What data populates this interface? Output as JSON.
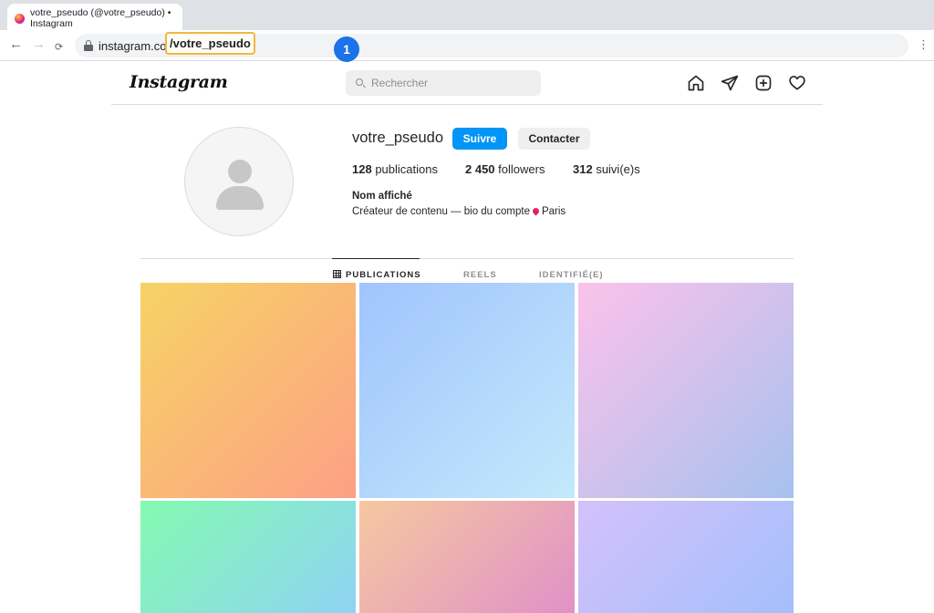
{
  "browser": {
    "tab_title": "votre_pseudo (@votre_pseudo) • Instagram",
    "nav": {
      "back": "←",
      "forward": "→",
      "reload": "⟳"
    },
    "url_domain": "instagram.com",
    "url_path": "/votre_pseudo",
    "step_badge": "1",
    "menu": "⋮"
  },
  "header": {
    "logo": "Instagram",
    "search_placeholder": "Rechercher",
    "icons": [
      "home-icon",
      "send-icon",
      "new-post-icon",
      "heart-icon"
    ]
  },
  "profile": {
    "username": "votre_pseudo",
    "follow_label": "Suivre",
    "contact_label": "Contacter",
    "posts_count": "128",
    "posts_label": " publications",
    "followers_count": "2 450",
    "followers_label": " followers",
    "following_count": "312",
    "following_label": " suivi(e)s",
    "display_name": "Nom affiché",
    "bio_text": "Créateur de contenu — bio du compte",
    "bio_location": "Paris"
  },
  "tabs": [
    {
      "label": "PUBLICATIONS",
      "active": true
    },
    {
      "label": "REELS",
      "active": false
    },
    {
      "label": "IDENTIFIÉ(E)",
      "active": false
    }
  ],
  "colors": {
    "follow_button": "#0095f6",
    "highlight_border": "#f4b73e",
    "step_badge": "#1a73e8"
  },
  "posts": [
    {
      "gradient": [
        "#f6d365",
        "#fda085"
      ]
    },
    {
      "gradient": [
        "#a1c4fd",
        "#c2e9fb"
      ]
    },
    {
      "gradient": [
        "#fbc2eb",
        "#a6c1ee"
      ]
    },
    {
      "gradient": [
        "#84fab0",
        "#8fd3f4"
      ]
    },
    {
      "gradient": [
        "#f6c89f",
        "#e091c8"
      ]
    },
    {
      "gradient": [
        "#d4c1fb",
        "#a3bffb"
      ]
    }
  ]
}
